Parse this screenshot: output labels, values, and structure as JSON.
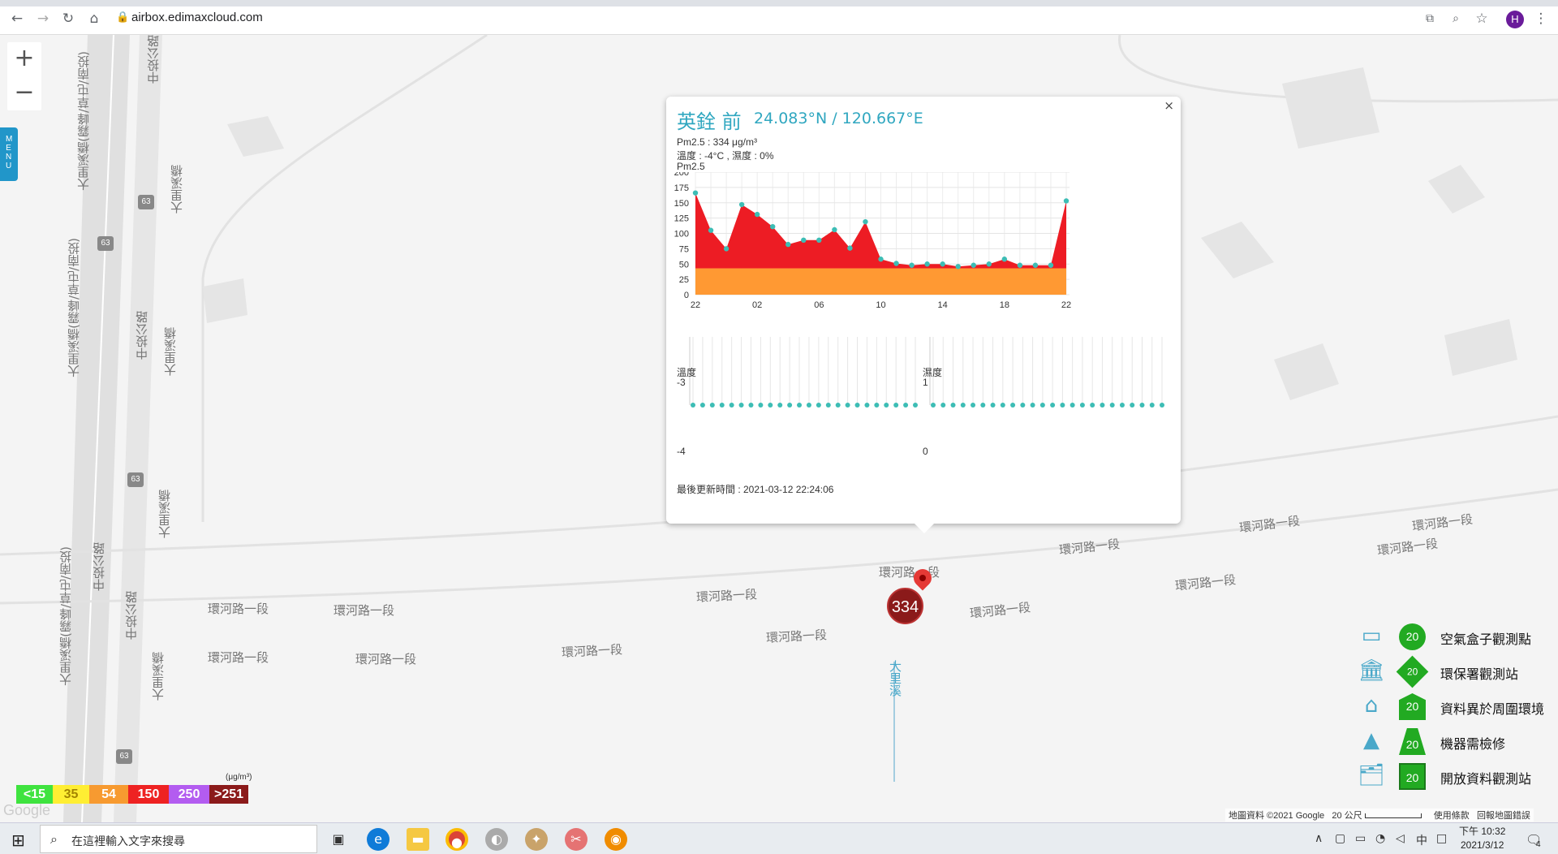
{
  "browser": {
    "url": "airbox.edimaxcloud.com",
    "avatar_letter": "H"
  },
  "map": {
    "zoom_in": "+",
    "zoom_out": "−",
    "menu_tab": "MENU",
    "road_labels": [
      {
        "text": "環河路一段"
      },
      {
        "text": "環河路一段"
      },
      {
        "text": "環河路一段"
      },
      {
        "text": "環河路一段"
      },
      {
        "text": "環河路一段"
      },
      {
        "text": "環河路一段"
      },
      {
        "text": "環河路一段"
      },
      {
        "text": "環河路一段"
      },
      {
        "text": "環河路一段"
      },
      {
        "text": "環河路一段"
      },
      {
        "text": "環河路一段"
      },
      {
        "text": "環河路一段"
      },
      {
        "text": "環河路一段"
      },
      {
        "text": "環河路一段"
      }
    ],
    "vertical_labels": [
      {
        "text": "大里溪橋(霧峰/草屯/南投)"
      },
      {
        "text": "大里溪橋(霧峰/草屯/南投)"
      },
      {
        "text": "大里溪橋(霧峰/草屯/南投)"
      },
      {
        "text": "中投公路"
      },
      {
        "text": "中投公路"
      },
      {
        "text": "中投公路"
      },
      {
        "text": "中投公路"
      },
      {
        "text": "大里溪橋"
      },
      {
        "text": "大里溪橋"
      },
      {
        "text": "大里溪橋"
      },
      {
        "text": "大里溪橋"
      },
      {
        "text": "大里溪"
      }
    ],
    "highway_shields": [
      "63",
      "63",
      "63",
      "63"
    ],
    "marker_value": "334",
    "google_watermark": "Google"
  },
  "popup": {
    "close": "×",
    "station_name": "英銓 前",
    "coordinates": "24.083°N / 120.667°E",
    "pm25_line": "Pm2.5 : 334 μg/m³",
    "temp_hum_line": "溫度 : -4°C , 濕度 : 0%",
    "chart_title": "Pm2.5",
    "temp_title": "溫度",
    "hum_title": "濕度",
    "temp_axis": [
      "-3",
      "-4"
    ],
    "hum_axis": [
      "1",
      "0"
    ],
    "last_update": "最後更新時間 : 2021-03-12 22:24:06"
  },
  "chart_data": {
    "type": "area",
    "title": "Pm2.5",
    "ylim": [
      0,
      200
    ],
    "yticks": [
      0,
      25,
      50,
      75,
      100,
      125,
      150,
      175,
      200
    ],
    "xtick_labels": [
      "22",
      "02",
      "06",
      "10",
      "14",
      "18",
      "22"
    ],
    "series": [
      {
        "values": [
          166,
          105,
          75,
          147,
          131,
          111,
          82,
          89,
          89,
          106,
          76,
          119,
          58,
          51,
          48,
          50,
          50,
          46,
          48,
          50,
          58,
          48,
          48,
          48,
          153
        ]
      }
    ],
    "bands": [
      {
        "from": 0,
        "to": 43,
        "color": "#ff9933"
      },
      {
        "from": 43,
        "to": 200,
        "color": "#ed1c24"
      }
    ],
    "temp_values": [
      -4,
      -4,
      -4,
      -4,
      -4,
      -4,
      -4,
      -4,
      -4,
      -4,
      -4,
      -4,
      -4,
      -4,
      -4,
      -4,
      -4,
      -4,
      -4,
      -4,
      -4,
      -4,
      -4,
      -4
    ],
    "hum_values": [
      0,
      0,
      0,
      0,
      0,
      0,
      0,
      0,
      0,
      0,
      0,
      0,
      0,
      0,
      0,
      0,
      0,
      0,
      0,
      0,
      0,
      0,
      0,
      0
    ],
    "point_color": "#3dbdb5"
  },
  "legend": {
    "items": [
      {
        "label": "空氣盒子觀測點",
        "value": "20",
        "icon": "airbox-icon"
      },
      {
        "label": "環保署觀測站",
        "value": "20",
        "icon": "government-building-icon"
      },
      {
        "label": "資料異於周圍環境",
        "value": "20",
        "icon": "home-icon"
      },
      {
        "label": "機器需檢修",
        "value": "20",
        "icon": "traffic-cone-icon"
      },
      {
        "label": "開放資料觀測站",
        "value": "20",
        "icon": "open-data-icon"
      }
    ]
  },
  "scale": {
    "unit": "(μg/m³)",
    "levels": [
      {
        "label": "<15",
        "color": "#3fe33f"
      },
      {
        "label": "35",
        "color": "#ffee33"
      },
      {
        "label": "54",
        "color": "#f79a30"
      },
      {
        "label": "150",
        "color": "#ee2222"
      },
      {
        "label": "250",
        "color": "#b35cf0"
      },
      {
        "label": ">251",
        "color": "#8b1a1a"
      }
    ]
  },
  "attribution": {
    "map_data": "地圖資料 ©2021 Google",
    "scale_text": "20 公尺",
    "terms": "使用條款",
    "report": "回報地圖錯誤"
  },
  "taskbar": {
    "search_placeholder": "在這裡輸入文字來搜尋",
    "ime": "中",
    "time": "下午 10:32",
    "date": "2021/3/12",
    "notification_count": "4"
  }
}
